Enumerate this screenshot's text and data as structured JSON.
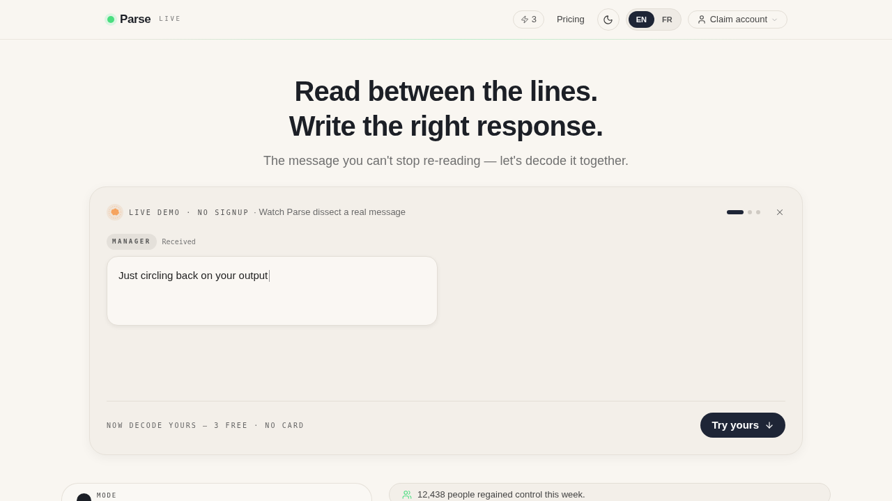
{
  "header": {
    "logo": {
      "name": "Parse",
      "badge": "LIVE"
    },
    "credits": {
      "count": "3"
    },
    "pricing_link": "Pricing",
    "languages": [
      {
        "label": "EN",
        "selected": true
      },
      {
        "label": "FR",
        "selected": false
      }
    ],
    "account_menu": {
      "label": "Claim account"
    }
  },
  "hero": {
    "title_lines": [
      "Read between the lines.",
      "Write the right response."
    ],
    "subtitle": "The message you can't stop re-reading — let's decode it together."
  },
  "demo_card": {
    "eyebrow": "LIVE DEMO · NO SIGNUP",
    "caption": "· Watch Parse dissect a real message",
    "steps": [
      {
        "selected": true
      },
      {
        "selected": false
      },
      {
        "selected": false
      }
    ],
    "message": {
      "sender": "MANAGER",
      "status": "Received",
      "text": "Just circling back on your output"
    },
    "footer_note": "NOW DECODE YOURS — 3 FREE · NO CARD",
    "cta": "Try yours"
  },
  "mode_panel": {
    "label": "MODE"
  },
  "social_proof": {
    "text": "12,438 people regained control this week."
  }
}
